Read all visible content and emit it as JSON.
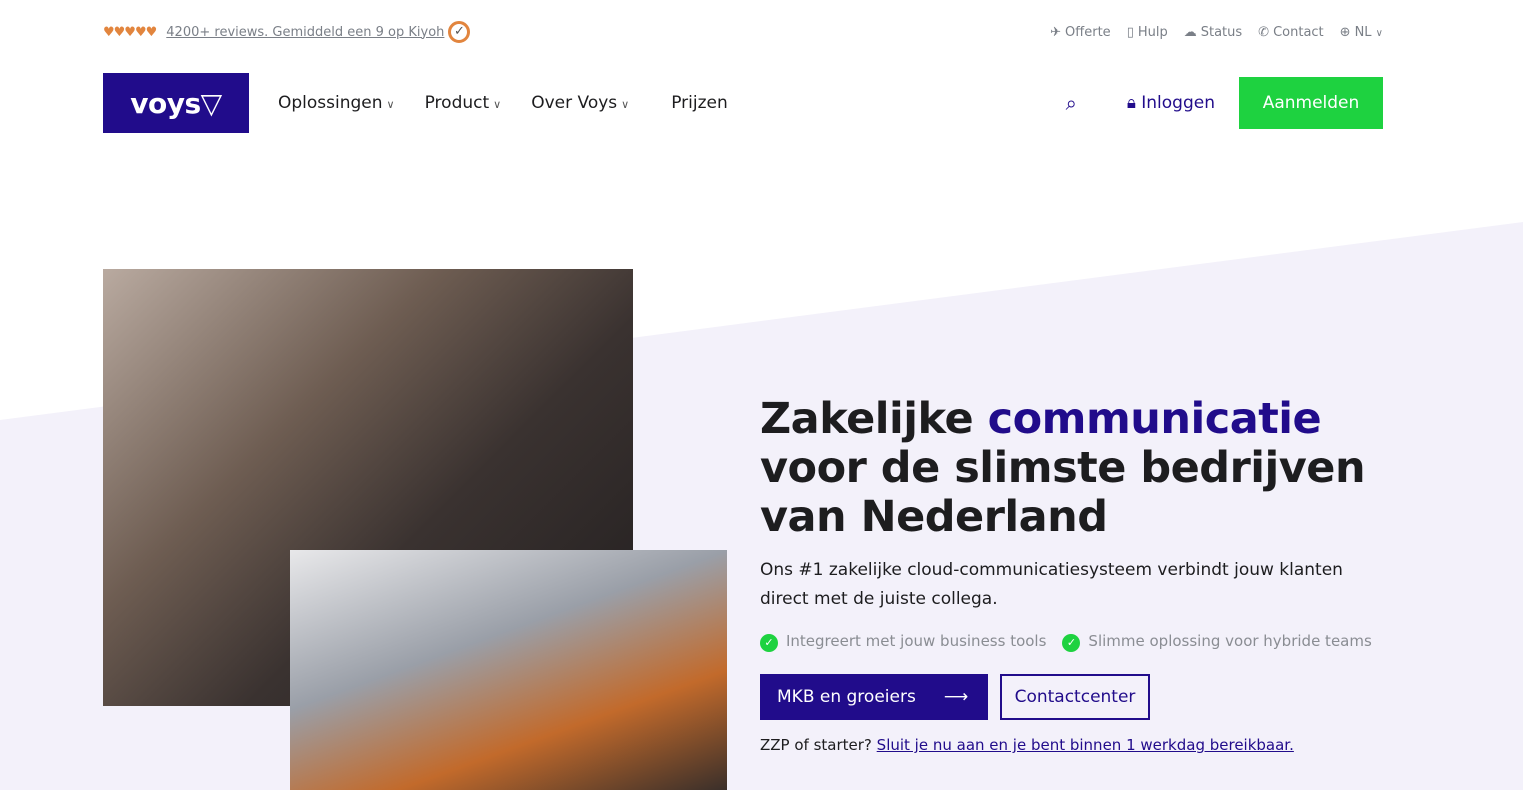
{
  "topbar": {
    "hearts": "♥♥♥♥♥",
    "reviews": "4200+ reviews. Gemiddeld een 9 op Kiyoh",
    "links": [
      {
        "icon": "quote-icon",
        "label": "Offerte"
      },
      {
        "icon": "book-icon",
        "label": "Hulp"
      },
      {
        "icon": "cloud-icon",
        "label": "Status"
      },
      {
        "icon": "phone-icon",
        "label": "Contact"
      }
    ],
    "language": "NL"
  },
  "nav": {
    "logo": "voys▽",
    "items": [
      "Oplossingen",
      "Product",
      "Over Voys",
      "Prijzen"
    ],
    "login": "Inloggen",
    "signup": "Aanmelden"
  },
  "hero": {
    "title_1": "Zakelijke ",
    "title_accent": "communicatie",
    "title_2": "voor de slimste bedrijven van Nederland",
    "subtitle": "Ons #1 zakelijke cloud-communicatiesysteem verbindt jouw klanten direct met de juiste collega.",
    "checks": [
      "Integreert met jouw business tools",
      "Slimme oplossing voor hybride teams"
    ],
    "primary_button": "MKB en groeiers",
    "secondary_button": "Contactcenter",
    "zzp_text": "ZZP of starter?",
    "zzp_link": "Sluit je nu aan en je bent binnen 1 werkdag bereikbaar."
  },
  "colors": {
    "brand": "#210c8b",
    "accent_green": "#1ed240",
    "hearts": "#e2853e",
    "background_shape": "#f3f1fa"
  }
}
